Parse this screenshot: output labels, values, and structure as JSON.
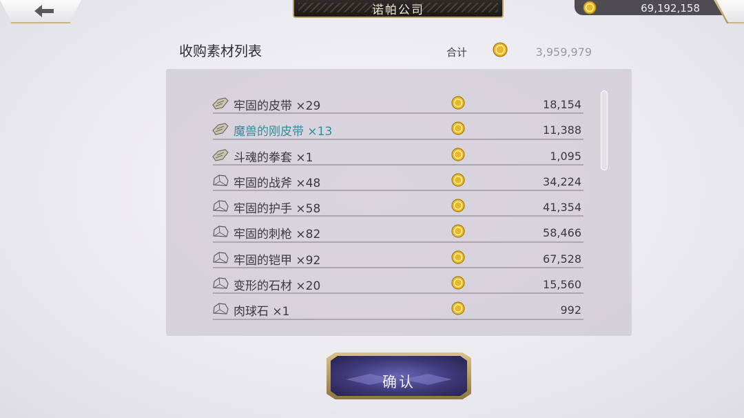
{
  "header": {
    "title": "诺帕公司",
    "currency_value": "69,192,158"
  },
  "list": {
    "title": "收购素材列表",
    "total_label": "合计",
    "total_value": "3,959,979",
    "items": [
      {
        "name": "牢固的皮带 ×29",
        "price": "18,154",
        "icon": "leather-material-icon",
        "highlighted": false
      },
      {
        "name": "魔兽的刚皮带 ×13",
        "price": "11,388",
        "icon": "leather-material-icon",
        "highlighted": true
      },
      {
        "name": "斗魂的拳套 ×1",
        "price": "1,095",
        "icon": "leather-material-icon",
        "highlighted": false
      },
      {
        "name": "牢固的战斧 ×48",
        "price": "34,224",
        "icon": "stone-material-icon",
        "highlighted": false
      },
      {
        "name": "牢固的护手 ×58",
        "price": "41,354",
        "icon": "stone-material-icon",
        "highlighted": false
      },
      {
        "name": "牢固的刺枪 ×82",
        "price": "58,466",
        "icon": "stone-material-icon",
        "highlighted": false
      },
      {
        "name": "牢固的铠甲 ×92",
        "price": "67,528",
        "icon": "stone-material-icon",
        "highlighted": false
      },
      {
        "name": "变形的石材 ×20",
        "price": "15,560",
        "icon": "stone-material-icon",
        "highlighted": false
      },
      {
        "name": "肉球石 ×1",
        "price": "992",
        "icon": "stone-material-icon",
        "highlighted": false
      }
    ]
  },
  "confirm_label": "确认",
  "colors": {
    "highlight_text": "#2b8f9e",
    "coin": "#e7b92a",
    "button": "#3e3a7a",
    "frame_gold": "#c9b77a"
  }
}
